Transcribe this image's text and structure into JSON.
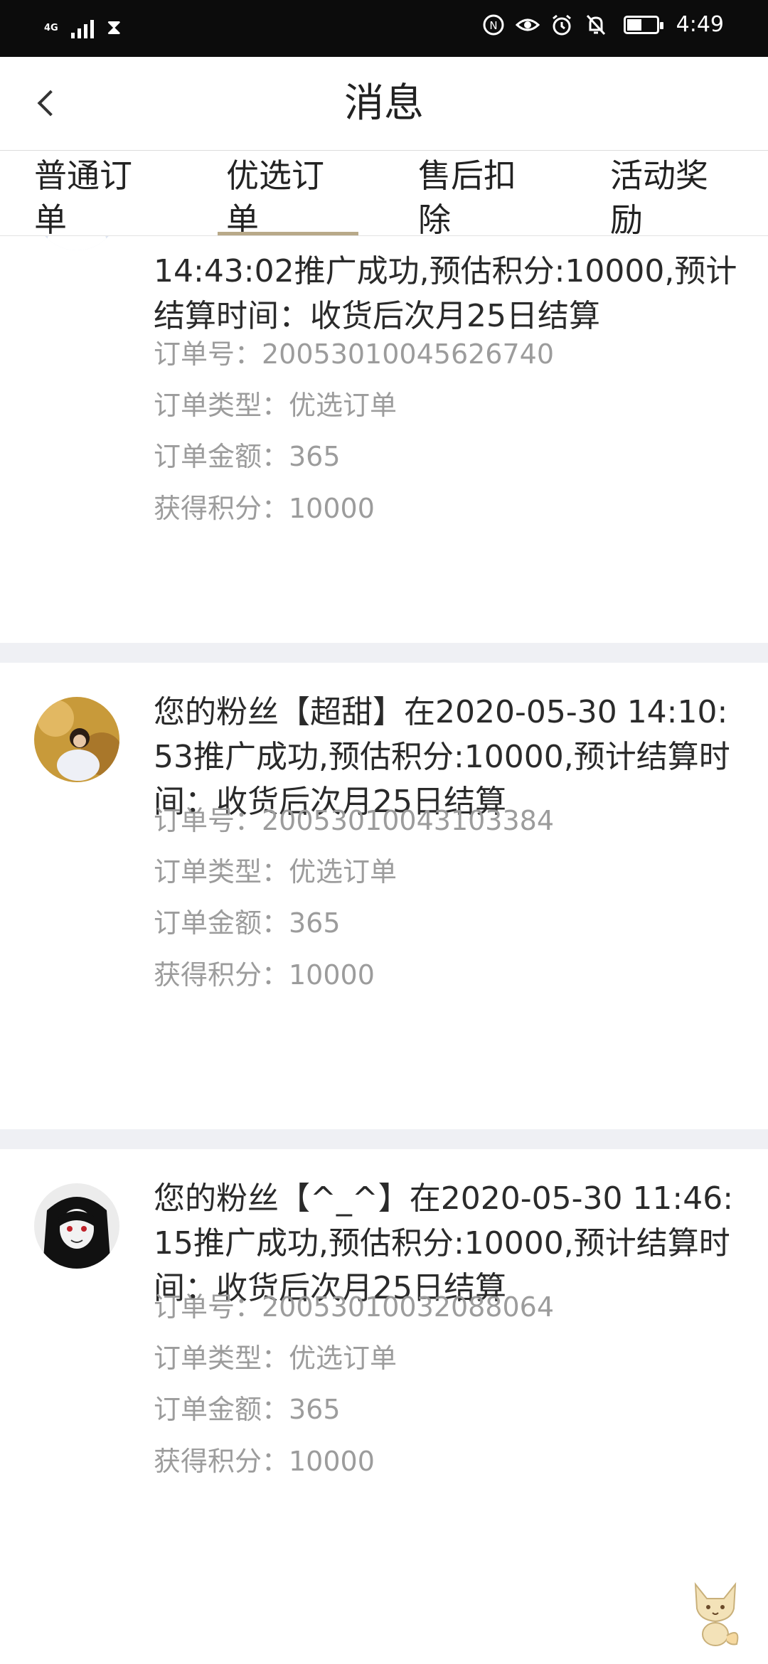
{
  "status_bar": {
    "network": "4G",
    "time": "4:49",
    "icons": [
      "signal-bars-icon",
      "hourglass-icon",
      "nfc-icon",
      "eye-icon",
      "alarm-icon",
      "bell-off-icon",
      "battery-icon"
    ]
  },
  "header": {
    "back_icon": "chevron-left-icon",
    "title": "消息"
  },
  "tabs": [
    {
      "label": "普通订单",
      "active": false
    },
    {
      "label": "优选订单",
      "active": true
    },
    {
      "label": "售后扣除",
      "active": false
    },
    {
      "label": "活动奖励",
      "active": false
    }
  ],
  "messages": [
    {
      "text": "14:43:02推广成功,预估积分:10000,预计结算时间：收货后次月25日结算",
      "order_no": "订单号：20053010045626740",
      "order_type": "订单类型：优选订单",
      "order_amount": "订单金额：365",
      "points": "获得积分：10000"
    },
    {
      "text": "您的粉丝【超甜】在2020-05-30 14:10:53推广成功,预估积分:10000,预计结算时间：收货后次月25日结算",
      "order_no": "订单号：20053010043103384",
      "order_type": "订单类型：优选订单",
      "order_amount": "订单金额：365",
      "points": "获得积分：10000"
    },
    {
      "text": "您的粉丝【^_^】在2020-05-30 11:46:15推广成功,预估积分:10000,预计结算时间：收货后次月25日结算",
      "order_no": "订单号：20053010032088064",
      "order_type": "订单类型：优选订单",
      "order_amount": "订单金额：365",
      "points": "获得积分：10000"
    }
  ],
  "colors": {
    "tab_underline": "#b8a989",
    "divider": "#eff0f4",
    "meta_text": "#9c9c9c",
    "status_bar": "#0c0c0c"
  },
  "floating_icon": "fox-mascot-icon"
}
